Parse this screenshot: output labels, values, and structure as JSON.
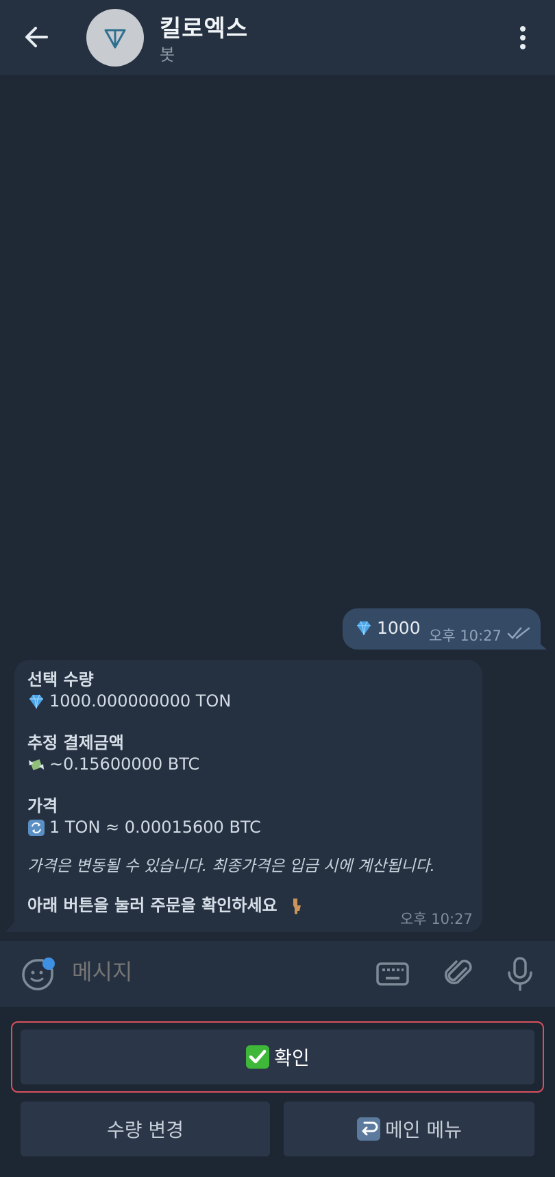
{
  "header": {
    "title": "킬로엑스",
    "subtitle": "봇",
    "back_icon": "arrow-left-icon",
    "menu_icon": "more-vertical-icon",
    "avatar_icon": "ton-logo-icon"
  },
  "messages": {
    "outgoing": {
      "emoji": "gem-icon",
      "text": "1000",
      "time": "오후 10:27",
      "status_icon": "double-check-icon"
    },
    "incoming": {
      "qty_label": "선택 수량",
      "qty_value": "1000.000000000 TON",
      "amount_label": "추정 결제금액",
      "amount_value": "~0.15600000 BTC",
      "price_label": "가격",
      "price_value": "1 TON ≈ 0.00015600 BTC",
      "note": "가격은 변동될 수 있습니다. 최종가격은 입금 시에 계산됩니다.",
      "instruction": "아래 버튼을 눌러 주문을 확인하세요",
      "time": "오후 10:27"
    }
  },
  "input": {
    "placeholder": "메시지"
  },
  "keyboard": {
    "confirm_label": "확인",
    "change_qty_label": "수량 변경",
    "main_menu_label": "메인 메뉴"
  },
  "colors": {
    "background": "#1f2936",
    "header": "#253141",
    "outgoing_bubble": "#354a65",
    "incoming_bubble": "#253141",
    "highlight_outline": "#d9515d"
  }
}
